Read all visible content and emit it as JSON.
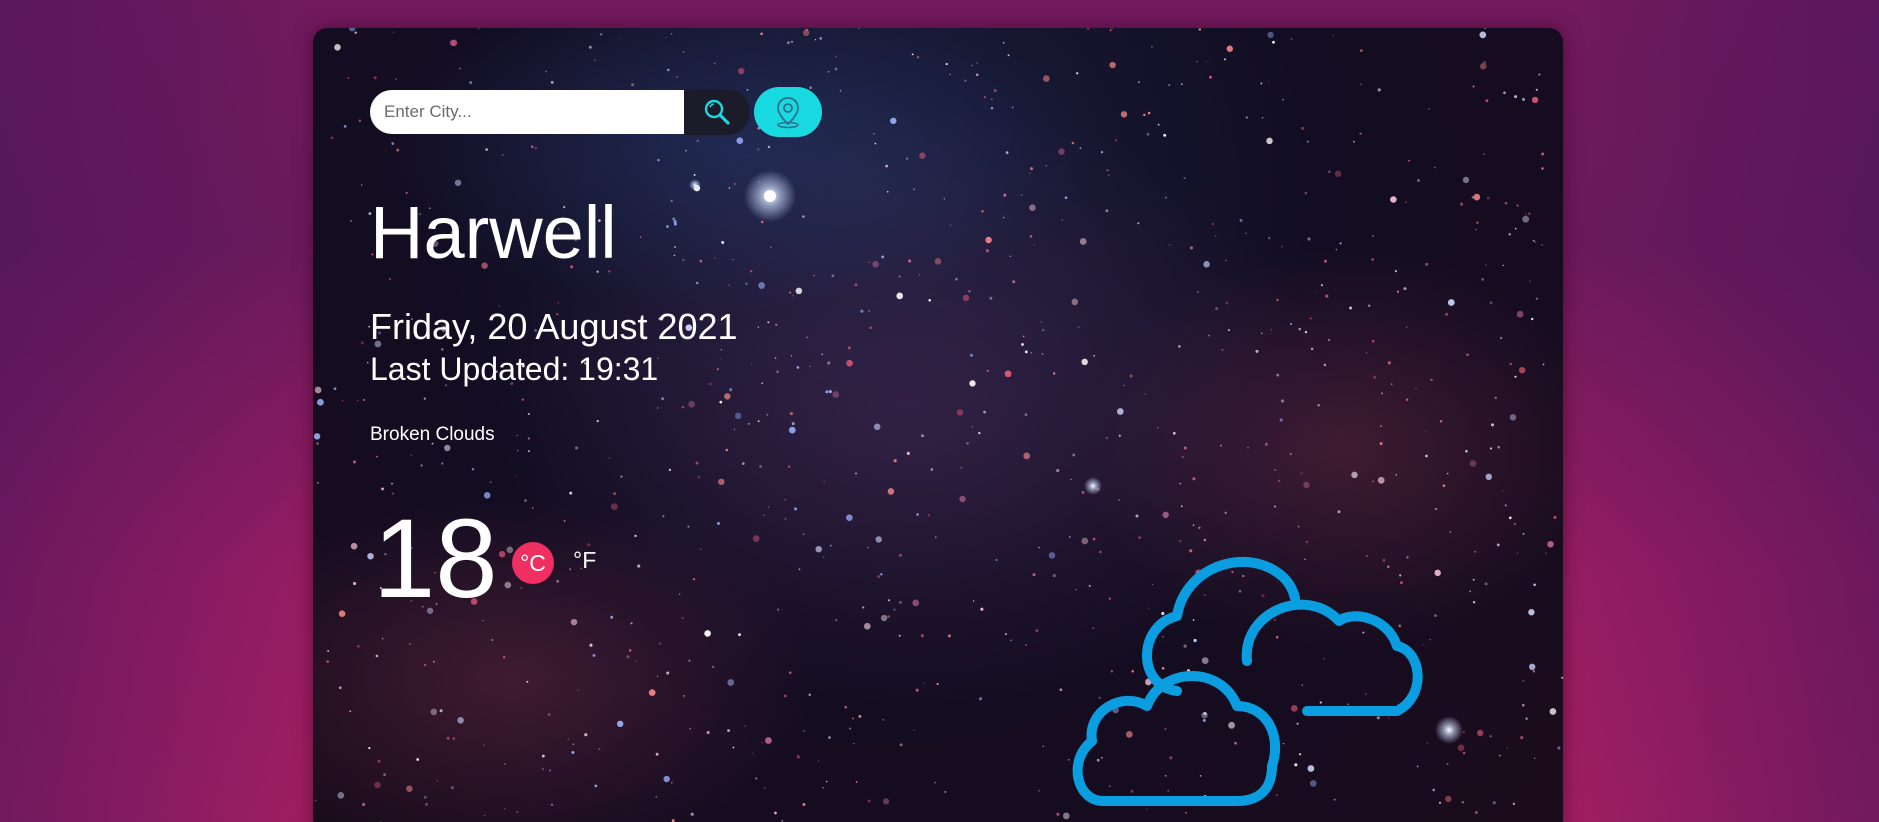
{
  "search": {
    "placeholder": "Enter City...",
    "icon": "search-icon",
    "location_icon": "location-pin-icon"
  },
  "weather": {
    "city": "Harwell",
    "date": "Friday, 20 August 2021",
    "last_updated": "Last Updated: 19:31",
    "description": "Broken Clouds",
    "temperature": "18",
    "unit_celsius": "°C",
    "unit_fahrenheit": "°F",
    "icon": "broken-clouds-icon"
  },
  "colors": {
    "accent_cyan": "#18d9e0",
    "celsius_badge": "#ef2f62",
    "cloud_icon": "#0a9ee0"
  }
}
